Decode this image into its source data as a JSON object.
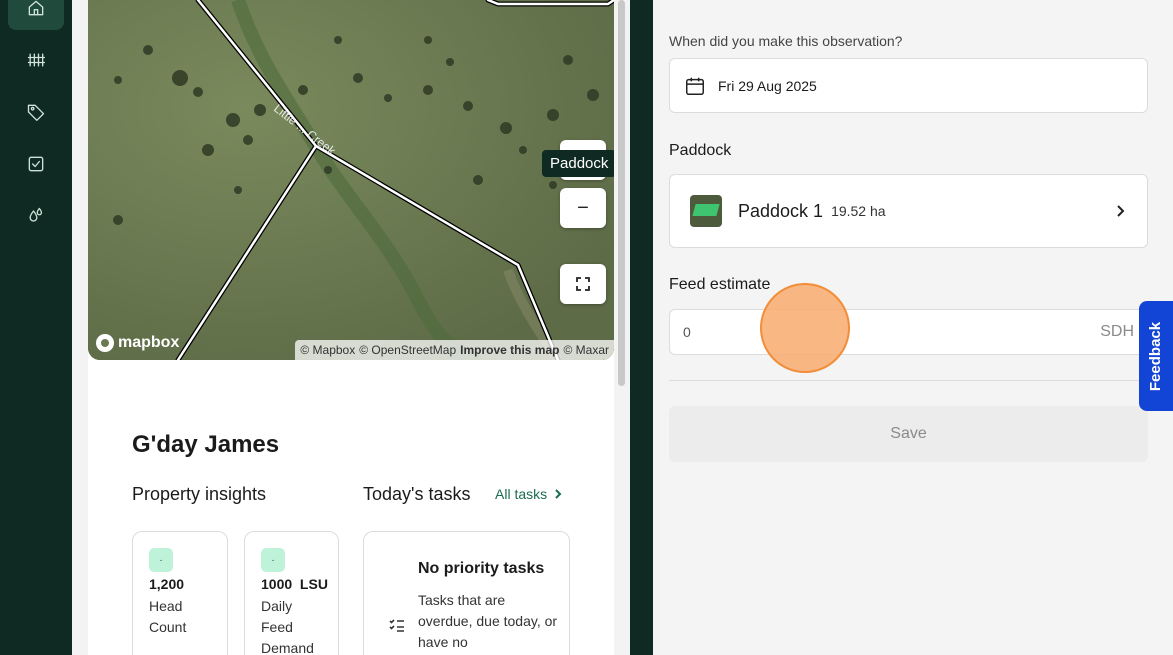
{
  "sidebar": {
    "items": [
      {
        "icon": "home-icon",
        "active": true
      },
      {
        "icon": "fence-icon",
        "active": false
      },
      {
        "icon": "tag-icon",
        "active": false
      },
      {
        "icon": "task-checkbox-icon",
        "active": false
      },
      {
        "icon": "drops-icon",
        "active": false
      }
    ]
  },
  "map": {
    "tooltip": "Paddock",
    "zoom_out_label": "−",
    "logo_text": "mapbox",
    "attribution": {
      "mapbox": "© Mapbox",
      "osm": "© OpenStreetMap",
      "improve": "Improve this map",
      "maxar": "© Maxar"
    },
    "creek_label": "Little ... Creek"
  },
  "dashboard": {
    "greeting": "G'day James",
    "insights_title": "Property insights",
    "tasks_title": "Today's tasks",
    "all_tasks_label": "All tasks",
    "cards": [
      {
        "chip": "·",
        "value": "1,200",
        "label": "Head Count"
      },
      {
        "chip": "·",
        "value": "1000  LSU",
        "label": "Daily Feed Demand"
      }
    ],
    "task_card": {
      "title": "No priority tasks",
      "description": "Tasks that are overdue, due today, or have no"
    }
  },
  "observation": {
    "date_question": "When did you make this observation?",
    "date_value": "Fri 29 Aug 2025",
    "paddock_heading": "Paddock",
    "paddock_name": "Paddock 1",
    "paddock_area": "19.52 ha",
    "feed_heading": "Feed estimate",
    "feed_value": "0",
    "feed_unit": "SDH",
    "save_label": "Save"
  },
  "feedback_label": "Feedback",
  "colors": {
    "sidebar_bg": "#0f2a22",
    "accent_green": "#1d6b50",
    "chip_green": "#bff3d9",
    "feedback_blue": "#1244d6",
    "cursor_orange": "#f28d3a"
  }
}
